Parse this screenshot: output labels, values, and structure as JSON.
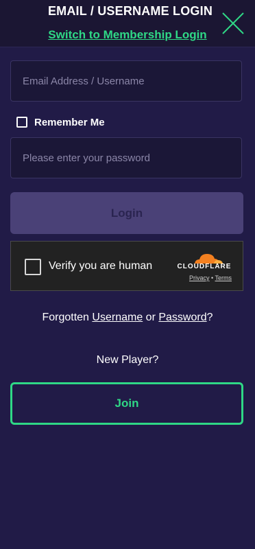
{
  "header": {
    "title": "EMAIL / USERNAME LOGIN",
    "switch_link": "Switch to Membership Login",
    "close_icon": "close-icon"
  },
  "form": {
    "email_placeholder": "Email Address / Username",
    "email_value": "",
    "remember_label": "Remember Me",
    "remember_checked": false,
    "password_placeholder": "Please enter your password",
    "password_value": "",
    "login_label": "Login"
  },
  "captcha": {
    "label": "Verify you are human",
    "provider": "CLOUDFLARE",
    "privacy": "Privacy",
    "separator": "•",
    "terms": "Terms"
  },
  "footer": {
    "forgot_prefix": "Forgotten",
    "forgot_username": "Username",
    "forgot_or": "or",
    "forgot_password": "Password",
    "forgot_suffix": "?",
    "new_player": "New Player?",
    "join_label": "Join"
  },
  "colors": {
    "accent": "#2fd886",
    "background": "#211b47",
    "header_bg": "#1b1633",
    "disabled_button": "#4a4177",
    "cloudflare_orange": "#f38020"
  }
}
